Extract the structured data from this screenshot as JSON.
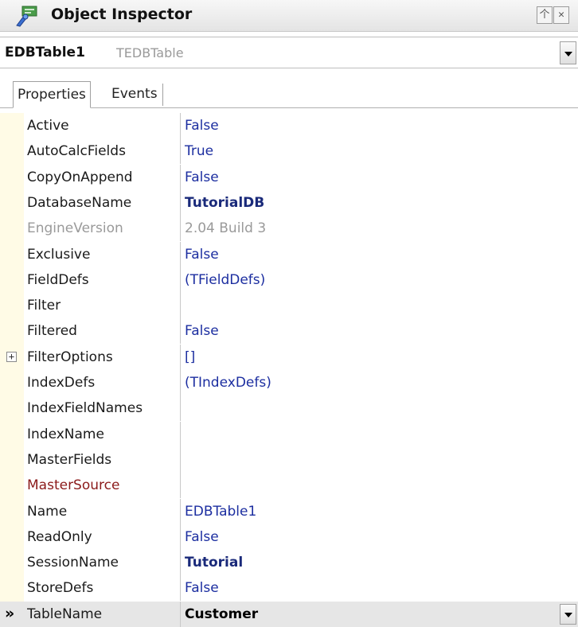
{
  "window": {
    "title": "Object Inspector",
    "pin_glyph": "个",
    "close_glyph": "✕",
    "icon": "object-inspector-icon"
  },
  "object_selector": {
    "name": "EDBTable1",
    "type": "TEDBTable"
  },
  "tabs": [
    {
      "label": "Properties",
      "active": true
    },
    {
      "label": "Events",
      "active": false
    }
  ],
  "properties": [
    {
      "name": "Active",
      "value": "False",
      "style": "normal"
    },
    {
      "name": "AutoCalcFields",
      "value": "True",
      "style": "normal"
    },
    {
      "name": "CopyOnAppend",
      "value": "False",
      "style": "normal"
    },
    {
      "name": "DatabaseName",
      "value": "TutorialDB",
      "style": "bold"
    },
    {
      "name": "EngineVersion",
      "value": "2.04 Build 3",
      "style": "grey"
    },
    {
      "name": "Exclusive",
      "value": "False",
      "style": "normal"
    },
    {
      "name": "FieldDefs",
      "value": "(TFieldDefs)",
      "style": "normal"
    },
    {
      "name": "Filter",
      "value": "",
      "style": "normal"
    },
    {
      "name": "Filtered",
      "value": "False",
      "style": "normal"
    },
    {
      "name": "FilterOptions",
      "value": "[]",
      "style": "normal",
      "expandable": true,
      "expander_glyph": "+"
    },
    {
      "name": "IndexDefs",
      "value": "(TIndexDefs)",
      "style": "normal"
    },
    {
      "name": "IndexFieldNames",
      "value": "",
      "style": "normal"
    },
    {
      "name": "IndexName",
      "value": "",
      "style": "normal"
    },
    {
      "name": "MasterFields",
      "value": "",
      "style": "normal"
    },
    {
      "name": "MasterSource",
      "value": "",
      "style": "maroon"
    },
    {
      "name": "Name",
      "value": "EDBTable1",
      "style": "normal"
    },
    {
      "name": "ReadOnly",
      "value": "False",
      "style": "normal"
    },
    {
      "name": "SessionName",
      "value": "Tutorial",
      "style": "bold"
    },
    {
      "name": "StoreDefs",
      "value": "False",
      "style": "normal"
    },
    {
      "name": "TableName",
      "value": "Customer",
      "style": "bold",
      "selected": true,
      "marker": "»"
    }
  ]
}
